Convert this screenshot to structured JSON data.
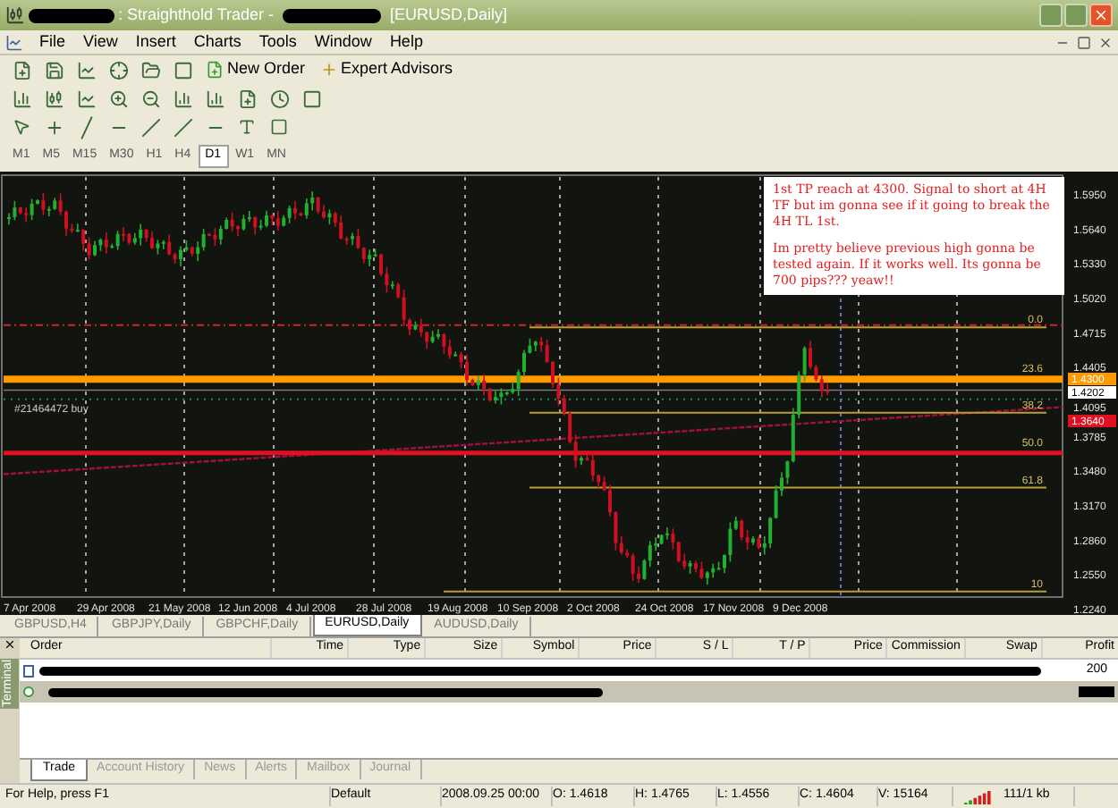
{
  "window": {
    "title": ": Straighthold Trader -",
    "document": "[EURUSD,Daily]"
  },
  "menu": [
    "File",
    "View",
    "Insert",
    "Charts",
    "Tools",
    "Window",
    "Help"
  ],
  "toolbar": {
    "buttons": [
      "New Order",
      "Expert Advisors"
    ]
  },
  "timeframes": [
    {
      "label": "M1",
      "selected": false
    },
    {
      "label": "M5",
      "selected": false
    },
    {
      "label": "M15",
      "selected": false
    },
    {
      "label": "M30",
      "selected": false
    },
    {
      "label": "H1",
      "selected": false
    },
    {
      "label": "H4",
      "selected": false
    },
    {
      "label": "D1",
      "selected": true
    },
    {
      "label": "W1",
      "selected": false
    },
    {
      "label": "MN",
      "selected": false
    }
  ],
  "chart": {
    "price_labels": [
      "1.5950",
      "1.5640",
      "1.5330",
      "1.5020",
      "1.4715",
      "1.4405",
      "1.4095",
      "1.3785",
      "1.3480",
      "1.3170",
      "1.2860",
      "1.2550",
      "1.2240"
    ],
    "date_labels": [
      "7 Apr 2008",
      "29 Apr 2008",
      "21 May 2008",
      "12 Jun 2008",
      "4 Jul 2008",
      "28 Jul 2008",
      "19 Aug 2008",
      "10 Sep 2008",
      "2 Oct 2008",
      "24 Oct 2008",
      "17 Nov 2008",
      "9 Dec 2008"
    ],
    "markers": [
      {
        "label": "1.4300",
        "color": "#ff9900"
      },
      {
        "label": "1.4202",
        "color": "#ffffff"
      },
      {
        "label": "1.3640",
        "color": "#e01020"
      }
    ],
    "fib_levels": [
      "0.0",
      "23.6",
      "38.2",
      "50.0",
      "61.8",
      "10"
    ],
    "order_label": "#21464472 buy",
    "note": [
      "1st TP reach at 4300. Signal to short at 4H TF but im gonna see if it going to break the 4H TL 1st.",
      "Im pretty believe previous high gonna be tested again. If it works well. Its gonna be 700 pips??? yeaw!!"
    ]
  },
  "chart_tabs": [
    {
      "label": "GBPUSD,H4",
      "selected": false
    },
    {
      "label": "GBPJPY,Daily",
      "selected": false
    },
    {
      "label": "GBPCHF,Daily",
      "selected": false
    },
    {
      "label": "EURUSD,Daily",
      "selected": true
    },
    {
      "label": "AUDUSD,Daily",
      "selected": false
    }
  ],
  "terminal": {
    "title": "Terminal",
    "columns": [
      "Order",
      "Time",
      "Type",
      "Size",
      "Symbol",
      "Price",
      "S / L",
      "T / P",
      "Price",
      "Commission",
      "Swap",
      "Profit"
    ],
    "rows": [
      {
        "profit": "200",
        "selected": false
      },
      {
        "selected": true
      }
    ],
    "tabs": [
      {
        "label": "Trade",
        "selected": true
      },
      {
        "label": "Account History",
        "selected": false
      },
      {
        "label": "News",
        "selected": false
      },
      {
        "label": "Alerts",
        "selected": false
      },
      {
        "label": "Mailbox",
        "selected": false
      },
      {
        "label": "Journal",
        "selected": false
      }
    ]
  },
  "status_bar": [
    "For Help, press F1",
    "Default",
    "2008.09.25 00:00",
    "O: 1.4618",
    "H: 1.4765",
    "L: 1.4556",
    "C: 1.4604",
    "V: 15164",
    "111/1 kb"
  ]
}
